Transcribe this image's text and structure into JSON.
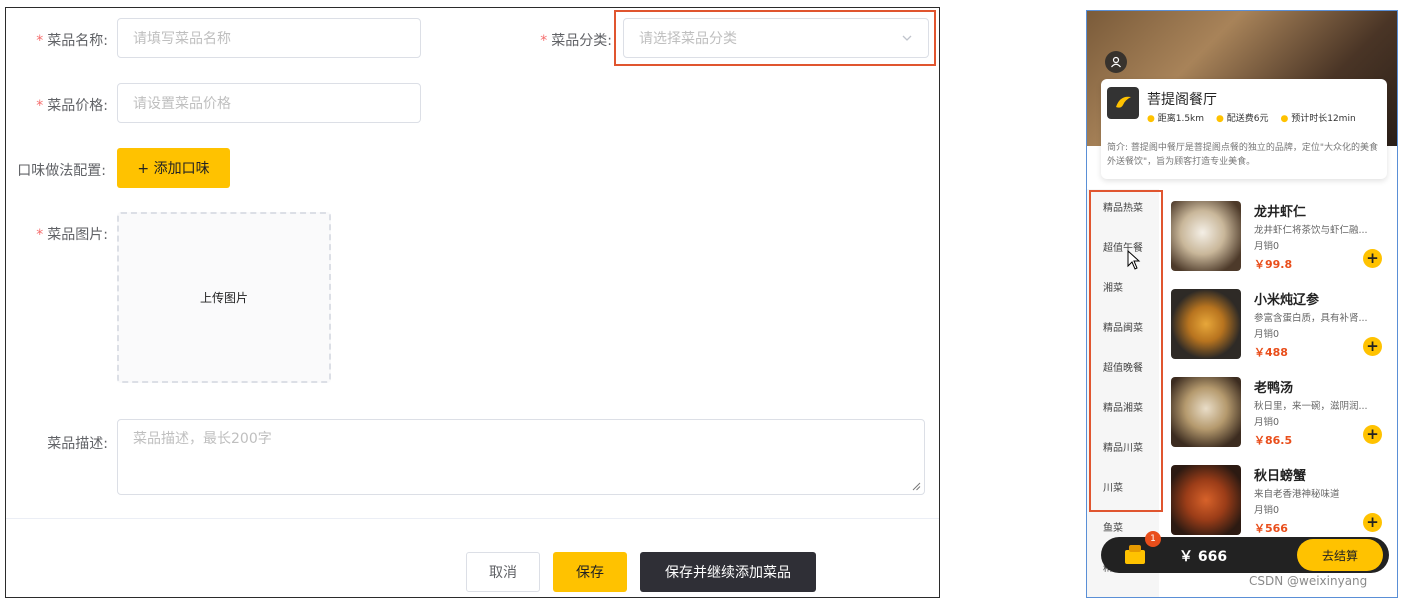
{
  "form": {
    "name_label": "菜品名称:",
    "name_placeholder": "请填写菜品名称",
    "category_label": "菜品分类:",
    "category_placeholder": "请选择菜品分类",
    "price_label": "菜品价格:",
    "price_placeholder": "请设置菜品价格",
    "flavor_label": "口味做法配置:",
    "flavor_button": "+ 添加口味",
    "image_label": "菜品图片:",
    "upload_label": "上传图片",
    "desc_label": "菜品描述:",
    "desc_placeholder": "菜品描述，最长200字",
    "required_mark": "*",
    "cancel_button": "取消",
    "save_button": "保存",
    "save_continue_button": "保存并继续添加菜品"
  },
  "phone": {
    "restaurant_name": "菩提阁餐厅",
    "distance": "距离1.5km",
    "delivery_fee": "配送费6元",
    "eta": "预计时长12min",
    "intro": "简介: 菩提阁中餐厅是菩提阁点餐的独立的品牌，定位\"大众化的美食外送餐饮\"，旨为顾客打造专业美食。",
    "categories": [
      "精品热菜",
      "超值午餐",
      "湘菜",
      "精品闽菜",
      "超值晚餐",
      "精品湘菜",
      "精品川菜",
      "川菜",
      "鱼菜",
      "精品蒸菜"
    ],
    "dishes": [
      {
        "name": "龙井虾仁",
        "desc": "龙井虾仁将茶饮与虾仁融...",
        "sales": "月销0",
        "price": "￥99.8"
      },
      {
        "name": "小米炖辽参",
        "desc": "参富含蛋白质，具有补肾...",
        "sales": "月销0",
        "price": "￥488"
      },
      {
        "name": "老鸭汤",
        "desc": "秋日里，来一碗，滋阴润...",
        "sales": "月销0",
        "price": "￥86.5"
      },
      {
        "name": "秋日螃蟹",
        "desc": "来自老香港神秘味道",
        "sales": "月销0",
        "price": "￥566"
      }
    ],
    "cart_count": "1",
    "cart_total": "￥ 666",
    "checkout_label": "去结算",
    "watermark": "CSDN @weixinyang"
  },
  "colors": {
    "accent": "#ffc200",
    "price": "#e94e1b",
    "highlight": "#e0552f",
    "dark_button": "#2f2f36"
  }
}
